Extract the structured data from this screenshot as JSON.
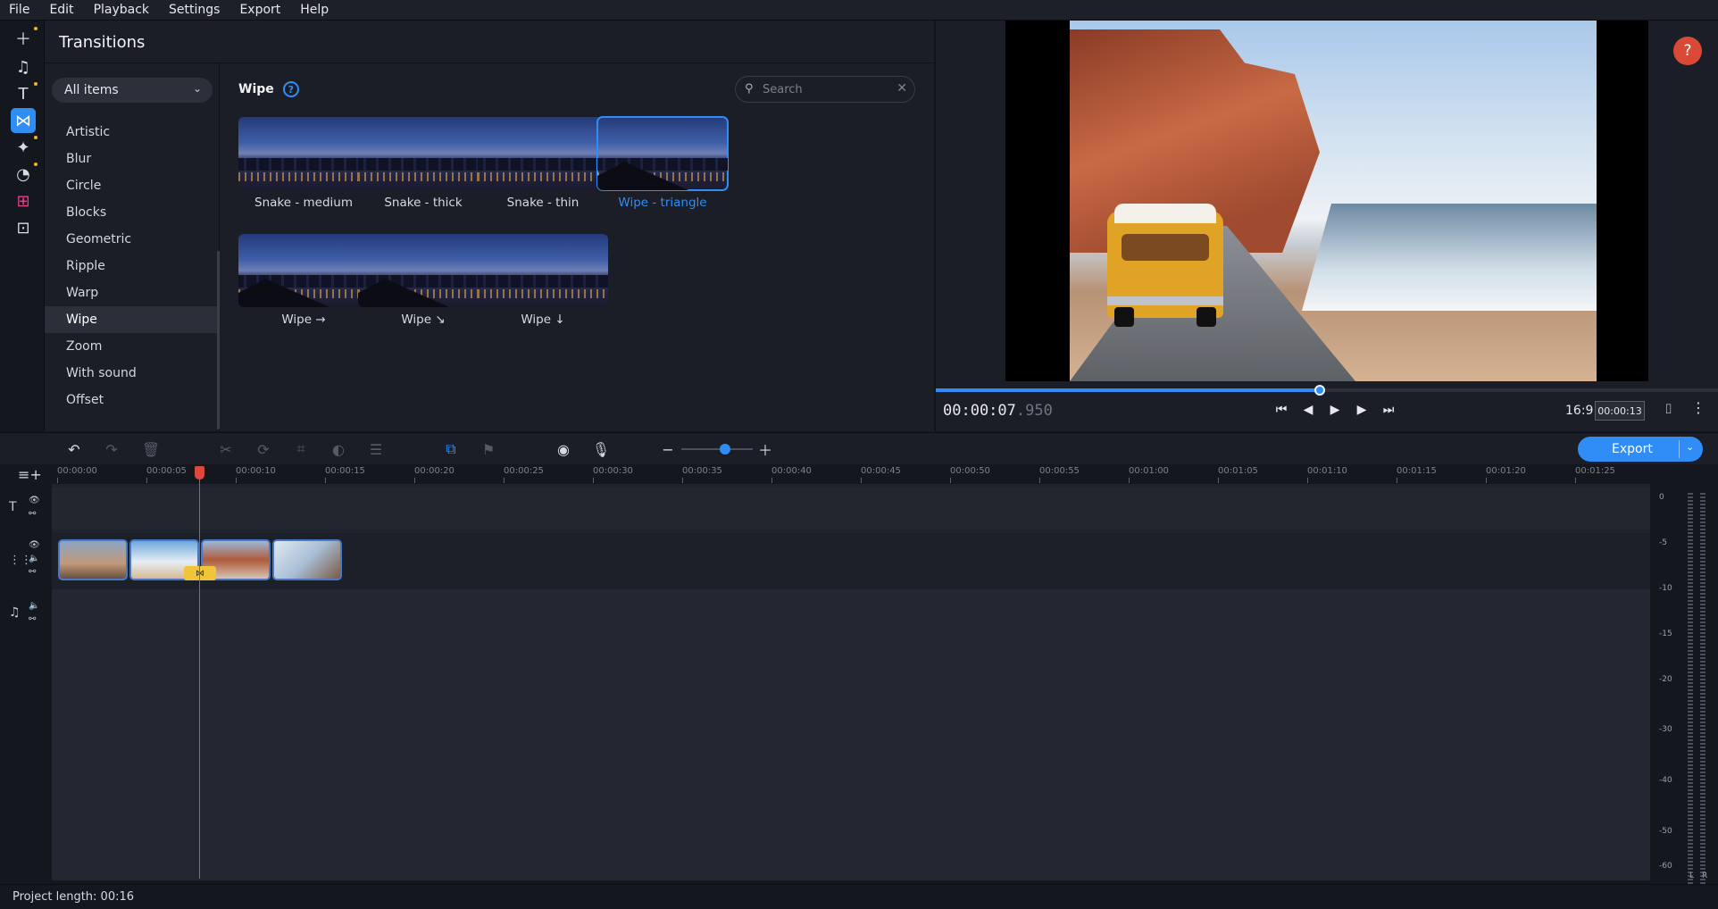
{
  "menu": [
    "File",
    "Edit",
    "Playback",
    "Settings",
    "Export",
    "Help"
  ],
  "panel": {
    "title": "Transitions",
    "filter": "All items",
    "categories": [
      "Artistic",
      "Blur",
      "Circle",
      "Blocks",
      "Geometric",
      "Ripple",
      "Warp",
      "Wipe",
      "Zoom",
      "With sound",
      "Offset"
    ],
    "selected_category": "Wipe",
    "section_title": "Wipe",
    "search_placeholder": "Search",
    "transitions": [
      "Snake - medium",
      "Snake - thick",
      "Snake - thin",
      "Wipe - triangle",
      "Wipe →",
      "Wipe ↘",
      "Wipe ↓"
    ],
    "selected_transition": "Wipe - triangle"
  },
  "preview": {
    "timecode_main": "00:00:07",
    "timecode_ms": ".950",
    "progress": 0.49,
    "aspect": "16:9",
    "duration": "00:00:13",
    "help": "?"
  },
  "toolbar": {
    "export_label": "Export"
  },
  "timeline": {
    "ticks": [
      "00:00:00",
      "00:00:05",
      "00:00:10",
      "00:00:15",
      "00:00:20",
      "00:00:25",
      "00:00:30",
      "00:00:35",
      "00:00:40",
      "00:00:45",
      "00:00:50",
      "00:00:55",
      "00:01:00",
      "00:01:05",
      "00:01:10",
      "00:01:15",
      "00:01:20",
      "00:01:25"
    ]
  },
  "meter": {
    "labels": [
      "0",
      "-5",
      "-10",
      "-15",
      "-20",
      "-30",
      "-40",
      "-50",
      "-60"
    ],
    "channels": [
      "L",
      "R"
    ]
  },
  "status": {
    "project_length": "Project length: 00:16"
  },
  "icons": {
    "add": "plus-icon",
    "music": "music-note-icon",
    "text": "text-icon",
    "transitions": "transitions-icon",
    "magic": "magic-wand-icon",
    "sticker": "sticker-icon",
    "more": "widgets-icon"
  },
  "colors": {
    "accent": "#2f8df5",
    "help_button": "#d94a36",
    "playhead": "#e0473c",
    "transition_marker": "#f0c53c"
  }
}
